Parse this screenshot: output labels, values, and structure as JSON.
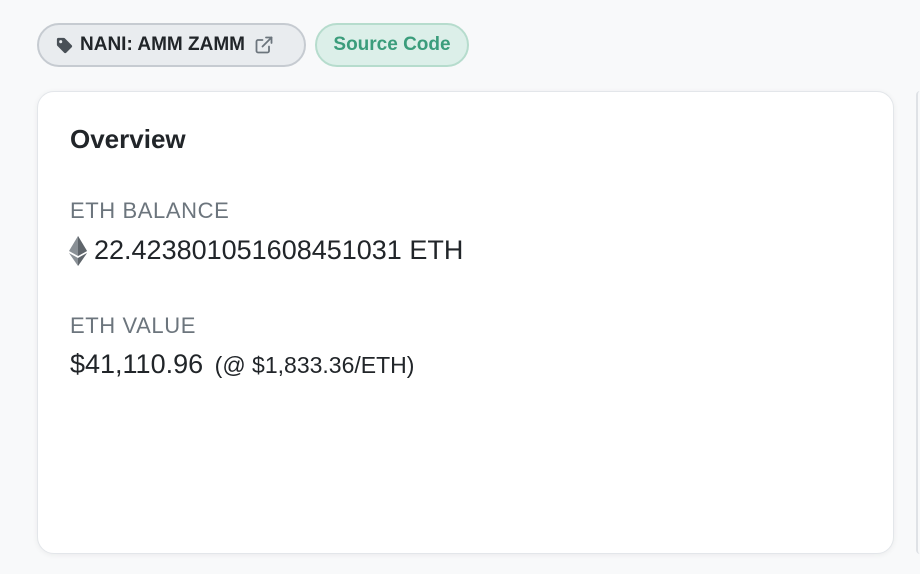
{
  "tags": {
    "name_tag": {
      "label": "NANI: AMM ZAMM",
      "icon": "tag-icon",
      "link_icon": "external-link-icon"
    },
    "source_code": {
      "label": "Source Code",
      "color": "#3b9d7c"
    }
  },
  "overview": {
    "title": "Overview",
    "eth_balance": {
      "label": "ETH BALANCE",
      "icon": "ethereum-icon",
      "value": "22.423801051608451031 ETH"
    },
    "eth_value": {
      "label": "ETH VALUE",
      "amount": "$41,110.96",
      "price": "(@ $1,833.36/ETH)"
    }
  }
}
